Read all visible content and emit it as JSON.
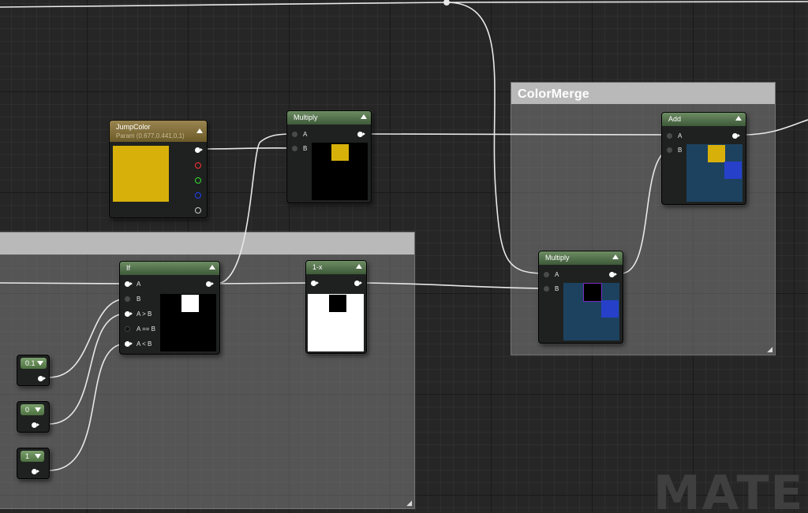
{
  "editor": {
    "watermark": "MATERI",
    "comments": {
      "color_merge": {
        "title": "ColorMerge"
      },
      "if_group": {
        "title": ""
      }
    }
  },
  "nodes": {
    "jump_color": {
      "title": "JumpColor",
      "subtitle": "Param (0.677,0.441,0,1)",
      "color": "#d8b00a",
      "output_pins": [
        "rgba",
        "r",
        "g",
        "b",
        "a"
      ],
      "pin_colors": [
        "#ffffff",
        "#ff3030",
        "#30e030",
        "#2040ff",
        "#cccccc"
      ]
    },
    "multiply_1": {
      "title": "Multiply",
      "pins": [
        "A",
        "B"
      ]
    },
    "add": {
      "title": "Add",
      "pins": [
        "A",
        "B"
      ]
    },
    "multiply_2": {
      "title": "Multiply",
      "pins": [
        "A",
        "B"
      ]
    },
    "if_node": {
      "title": "If",
      "pins": [
        "A",
        "B",
        "A > B",
        "A == B",
        "A < B"
      ]
    },
    "one_minus": {
      "title": "1-x"
    },
    "const_01": {
      "value": "0.1"
    },
    "const_0": {
      "value": "0"
    },
    "const_1": {
      "value": "1"
    }
  },
  "colors": {
    "preview_blue": "#1c4260",
    "preview_square_blue": "#2740c9",
    "preview_yellow": "#d8b00a"
  }
}
